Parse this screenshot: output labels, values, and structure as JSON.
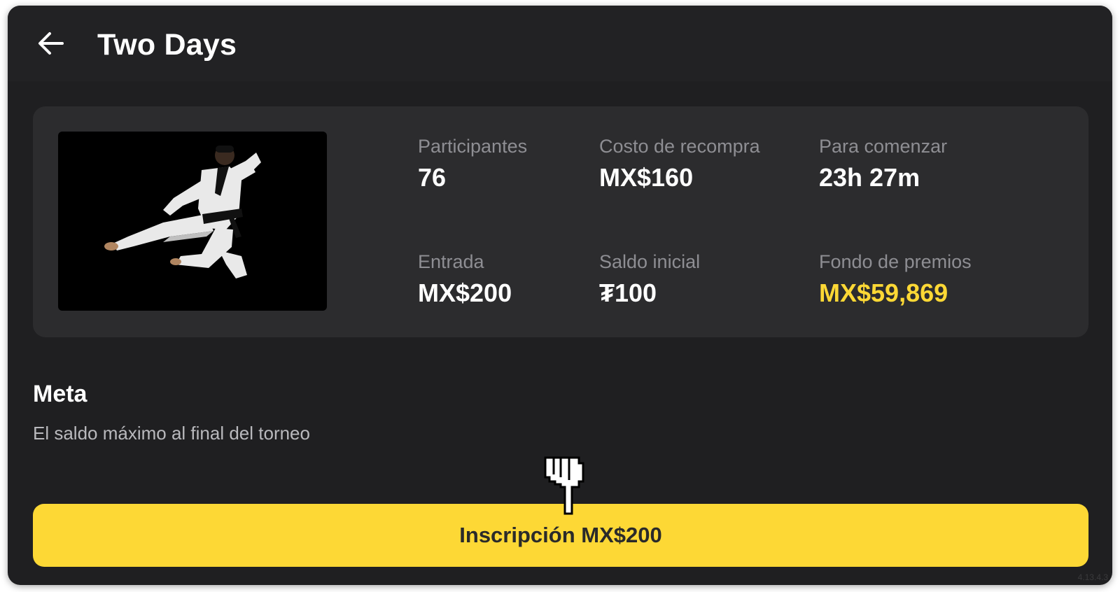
{
  "header": {
    "title": "Two Days",
    "back_icon": "arrow-left-icon"
  },
  "tournament": {
    "image_subject": "martial-artist-kick-image",
    "stats": [
      {
        "label": "Participantes",
        "value": "76",
        "accent": false
      },
      {
        "label": "Costo de recompra",
        "value": "MX$160",
        "accent": false
      },
      {
        "label": "Para comenzar",
        "value": "23h 27m",
        "accent": false
      },
      {
        "label": "Entrada",
        "value": "MX$200",
        "accent": false
      },
      {
        "label": "Saldo inicial",
        "value": "₮100",
        "accent": false
      },
      {
        "label": "Fondo de premios",
        "value": "MX$59,869",
        "accent": true
      }
    ]
  },
  "goal": {
    "title": "Meta",
    "description": "El saldo máximo al final del torneo"
  },
  "cta": {
    "label": "Inscripción MX$200"
  },
  "version": "4.13.4.3",
  "colors": {
    "background": "#1f1f21",
    "card": "#2c2c2e",
    "accent": "#fdd835",
    "text": "#ffffff",
    "muted": "#8e8e93"
  }
}
